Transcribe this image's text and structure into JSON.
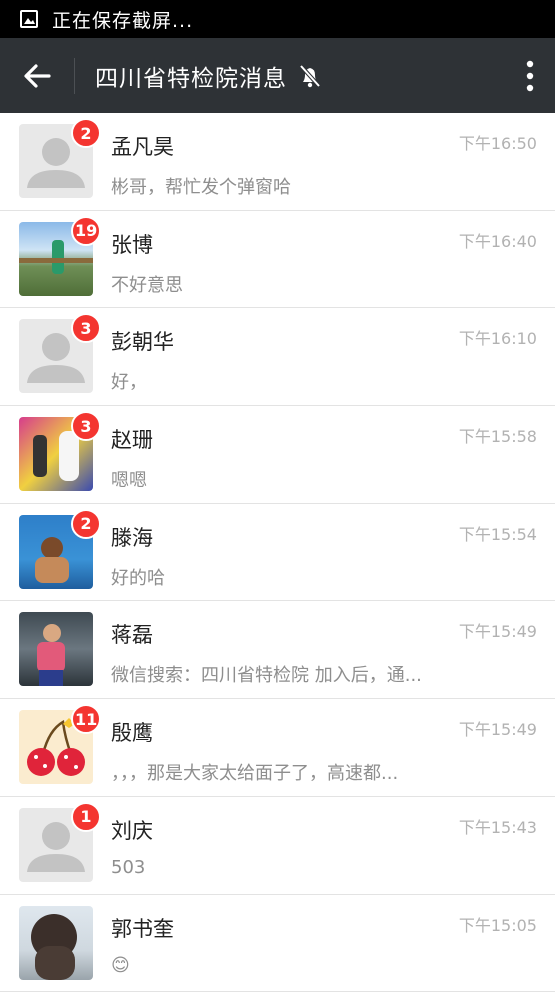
{
  "status_bar": {
    "icon": "image-icon",
    "text": "正在保存截屏..."
  },
  "header": {
    "back_icon": "arrow-left-icon",
    "title": "四川省特检院消息",
    "mute_icon": "bell-off-icon",
    "more_icon": "more-vertical-icon"
  },
  "chats": [
    {
      "name": "孟凡昊",
      "time": "下午16:50",
      "message": "彬哥，帮忙发个弹窗哈",
      "badge": "2",
      "avatar": "default"
    },
    {
      "name": "张博",
      "time": "下午16:40",
      "message": "不好意思",
      "badge": "19",
      "avatar": "photo-landscape"
    },
    {
      "name": "彭朝华",
      "time": "下午16:10",
      "message": "好，",
      "badge": "3",
      "avatar": "default"
    },
    {
      "name": "赵珊",
      "time": "下午15:58",
      "message": "嗯嗯",
      "badge": "3",
      "avatar": "photo-couple"
    },
    {
      "name": "滕海",
      "time": "下午15:54",
      "message": "好的哈",
      "badge": "2",
      "avatar": "photo-boy"
    },
    {
      "name": "蒋磊",
      "time": "下午15:49",
      "message": "微信搜索：四川省特检院 加入后，通...",
      "badge": "",
      "avatar": "photo-man"
    },
    {
      "name": "殷鹰",
      "time": "下午15:49",
      "message": "，，，那是大家太给面子了，高速都...",
      "badge": "11",
      "avatar": "cherry"
    },
    {
      "name": "刘庆",
      "time": "下午15:43",
      "message": "503",
      "badge": "1",
      "avatar": "default"
    },
    {
      "name": "郭书奎",
      "time": "下午15:05",
      "message": "😊",
      "badge": "",
      "avatar": "photo-dog"
    }
  ]
}
